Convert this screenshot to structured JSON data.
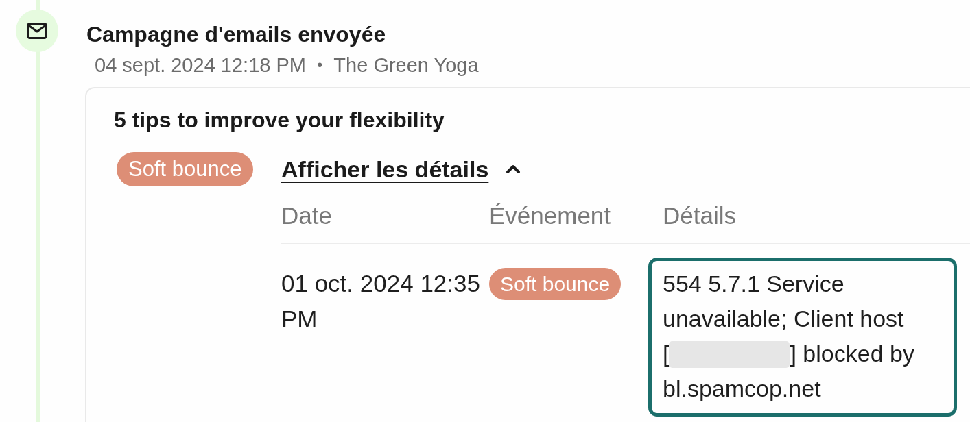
{
  "event": {
    "title": "Campagne d'emails envoyée",
    "date": "04 sept. 2024 12:18 PM",
    "separator": "•",
    "sender": "The Green Yoga"
  },
  "campaign": {
    "subject": "5 tips to improve your flexibility",
    "status": {
      "label": "Soft bounce",
      "kind": "soft_bounce"
    },
    "details_toggle": {
      "label": "Afficher les détails",
      "expanded": true
    },
    "table": {
      "columns": [
        "Date",
        "Événement",
        "Détails"
      ],
      "rows": [
        {
          "date": "01 oct. 2024 12:35 PM",
          "event": {
            "label": "Soft bounce",
            "kind": "soft_bounce"
          },
          "details": {
            "highlighted": true,
            "message": "554 5.7.1 Service unavailable; Client host",
            "blocked_line": {
              "prefix": "[",
              "redacted": true,
              "suffix": "] blocked by"
            },
            "message_end": "bl.spamcop.net"
          }
        }
      ]
    }
  }
}
